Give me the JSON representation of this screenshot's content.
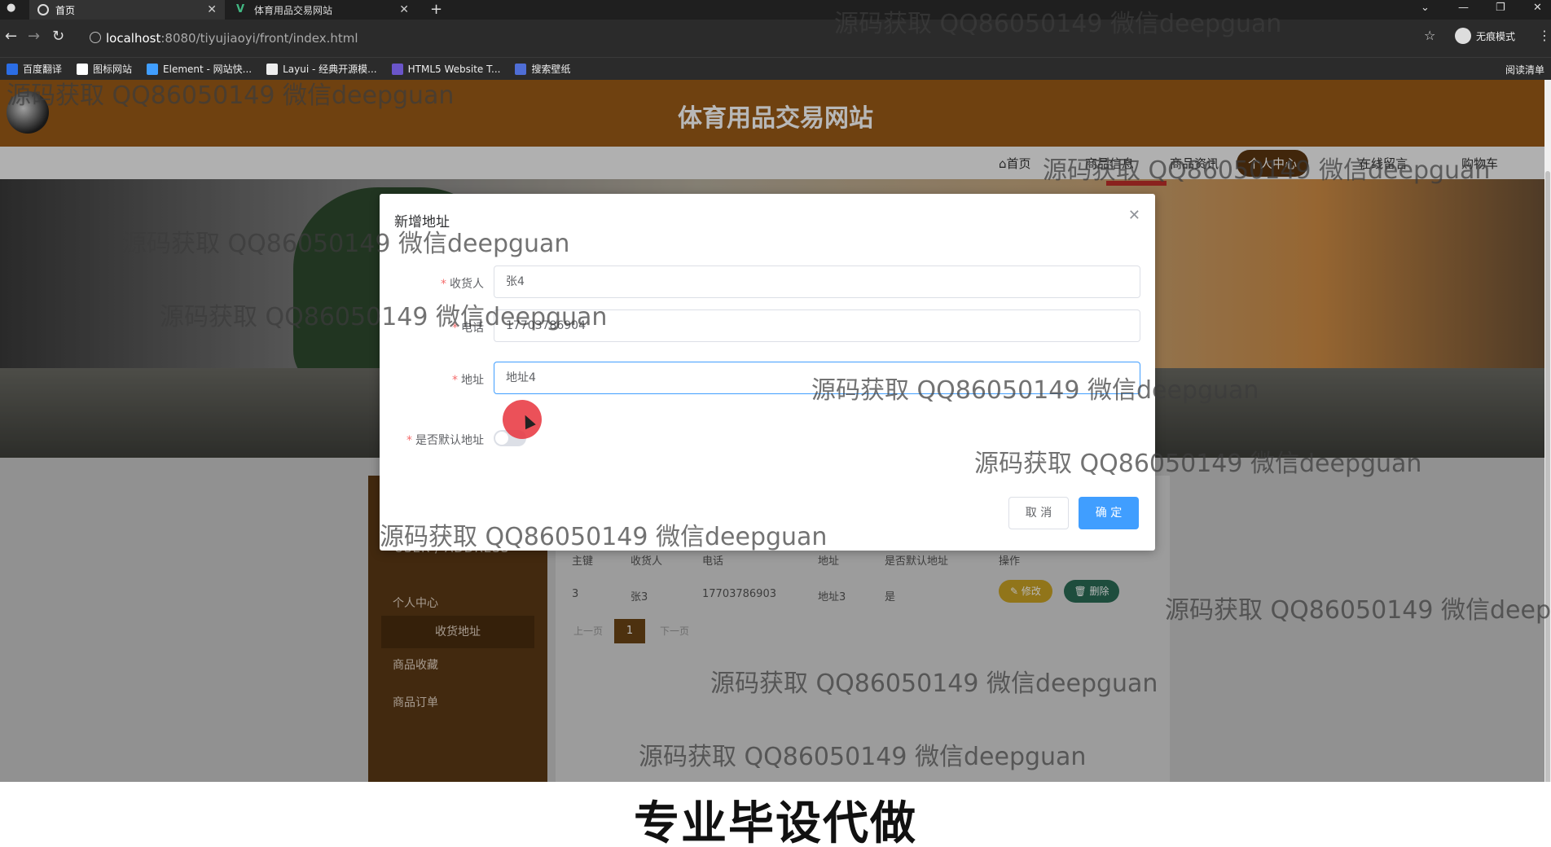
{
  "browser": {
    "tabs": [
      {
        "title": "首页",
        "active": true
      },
      {
        "title": "体育用品交易网站",
        "active": false
      }
    ],
    "url_host": "localhost",
    "url_path": ":8080/tiyujiaoyi/front/index.html",
    "profile_label": "无痕模式",
    "bookmarks": [
      {
        "label": "百度翻译",
        "color": "#2b6de5"
      },
      {
        "label": "图标网站",
        "color": "#ffffff"
      },
      {
        "label": "Element - 网站快...",
        "color": "#409eff"
      },
      {
        "label": "Layui - 经典开源模...",
        "color": "#ffffff"
      },
      {
        "label": "HTML5 Website T...",
        "color": "#6a55c9"
      },
      {
        "label": "搜索壁纸",
        "color": "#4f6ed6"
      }
    ],
    "reading_list": "阅读清单"
  },
  "site": {
    "title": "体育用品交易网站",
    "nav": [
      "首页",
      "商品信息",
      "商品资讯",
      "个人中心",
      "在线留言",
      "购物车"
    ],
    "sidebar": {
      "title": "USER / ADDRESS",
      "items": [
        "个人中心",
        "收货地址",
        "商品收藏",
        "商品订单"
      ]
    },
    "table": {
      "headers": [
        "主键",
        "收货人",
        "电话",
        "地址",
        "是否默认地址",
        "操作"
      ],
      "rows": [
        {
          "id": "3",
          "name": "张3",
          "phone": "17703786903",
          "address": "地址3",
          "default": "是"
        }
      ],
      "edit_label": "修改",
      "delete_label": "删除"
    },
    "pagination": {
      "prev": "上一页",
      "current": "1",
      "next": "下一页"
    }
  },
  "modal": {
    "title": "新增地址",
    "fields": [
      {
        "label": "收货人",
        "value": "张4"
      },
      {
        "label": "电话",
        "value": "17703786904"
      },
      {
        "label": "地址",
        "value": "地址4"
      }
    ],
    "switch_label": "是否默认地址",
    "switch_on": false,
    "cancel_label": "取 消",
    "confirm_label": "确 定"
  },
  "caption": "专业毕设代做",
  "watermark_text": "源码获取 QQ86050149 微信deepguan",
  "colors": {
    "header": "#9a5a17",
    "sidebar": "#5c3a16",
    "primary": "#409eff"
  }
}
